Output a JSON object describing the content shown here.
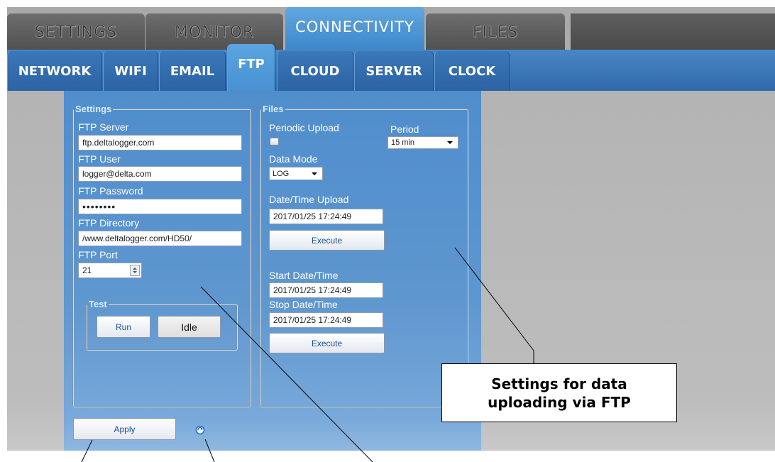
{
  "main_tabs": [
    {
      "label": "SETTINGS"
    },
    {
      "label": "MONITOR"
    },
    {
      "label": "CONNECTIVITY"
    },
    {
      "label": "FILES"
    }
  ],
  "sub_tabs": [
    {
      "label": "NETWORK"
    },
    {
      "label": "WIFI"
    },
    {
      "label": "EMAIL"
    },
    {
      "label": "FTP"
    },
    {
      "label": "CLOUD"
    },
    {
      "label": "SERVER"
    },
    {
      "label": "CLOCK"
    }
  ],
  "settings": {
    "legend": "Settings",
    "server_label": "FTP Server",
    "server_value": "ftp.deltalogger.com",
    "user_label": "FTP User",
    "user_value": "logger@delta.com",
    "password_label": "FTP Password",
    "password_value": "••••••••",
    "directory_label": "FTP Directory",
    "directory_value": "/www.deltalogger.com/HD50/",
    "port_label": "FTP Port",
    "port_value": "21"
  },
  "test": {
    "legend": "Test",
    "run_label": "Run",
    "status": "Idle"
  },
  "files": {
    "legend": "Files",
    "periodic_label": "Periodic Upload",
    "periodic_checked": false,
    "period_label": "Period",
    "period_value": "15 min",
    "data_mode_label": "Data Mode",
    "data_mode_value": "LOG",
    "datetime_upload_label": "Date/Time Upload",
    "datetime_upload_value": "2017/01/25 17:24:49",
    "execute_label": "Execute",
    "start_label": "Start Date/Time",
    "start_value": "2017/01/25 17:24:49",
    "stop_label": "Stop Date/Time",
    "stop_value": "2017/01/25 17:24:49",
    "execute2_label": "Execute"
  },
  "footer": {
    "apply_label": "Apply"
  },
  "callout": {
    "line1": "Settings for data",
    "line2": "uploading via FTP"
  }
}
